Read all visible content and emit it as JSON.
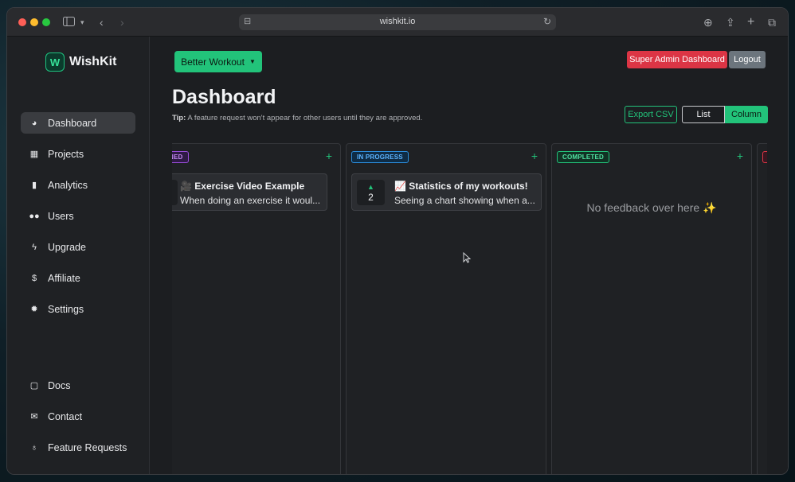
{
  "browser": {
    "url": "wishkit.io"
  },
  "sidebar": {
    "brand": "WishKit",
    "logo_glyph": "W",
    "items": [
      {
        "label": "Dashboard",
        "icon": "palette-icon"
      },
      {
        "label": "Projects",
        "icon": "grid-icon"
      },
      {
        "label": "Analytics",
        "icon": "bar-chart-icon"
      },
      {
        "label": "Users",
        "icon": "users-icon"
      },
      {
        "label": "Upgrade",
        "icon": "bolt-icon"
      },
      {
        "label": "Affiliate",
        "icon": "dollar-icon"
      },
      {
        "label": "Settings",
        "icon": "gear-icon"
      }
    ],
    "bottom_items": [
      {
        "label": "Docs",
        "icon": "docs-icon"
      },
      {
        "label": "Contact",
        "icon": "envelope-icon"
      },
      {
        "label": "Feature Requests",
        "icon": "lightbulb-icon"
      }
    ]
  },
  "header": {
    "project_selector": "Better Workout",
    "admin_button": "Super Admin Dashboard",
    "logout_button": "Logout",
    "title": "Dashboard",
    "tip_label": "Tip:",
    "tip_text": "A feature request won't appear for other users until they are approved.",
    "export_button": "Export CSV",
    "view_list": "List",
    "view_column": "Column",
    "active_view": "Column"
  },
  "board": {
    "columns": [
      {
        "badge": "NED",
        "cards": [
          {
            "title": "🎥 Exercise Video Example",
            "description": "When doing an exercise it woul..."
          }
        ]
      },
      {
        "badge": "IN PROGRESS",
        "cards": [
          {
            "votes": "2",
            "title": "📈 Statistics of my workouts!",
            "description": "Seeing a chart showing when a..."
          }
        ]
      },
      {
        "badge": "COMPLETED",
        "empty_message": "No feedback over here ✨"
      }
    ]
  },
  "colors": {
    "accent": "#22c37a",
    "danger": "#dc3545",
    "secondary": "#6c757d"
  }
}
